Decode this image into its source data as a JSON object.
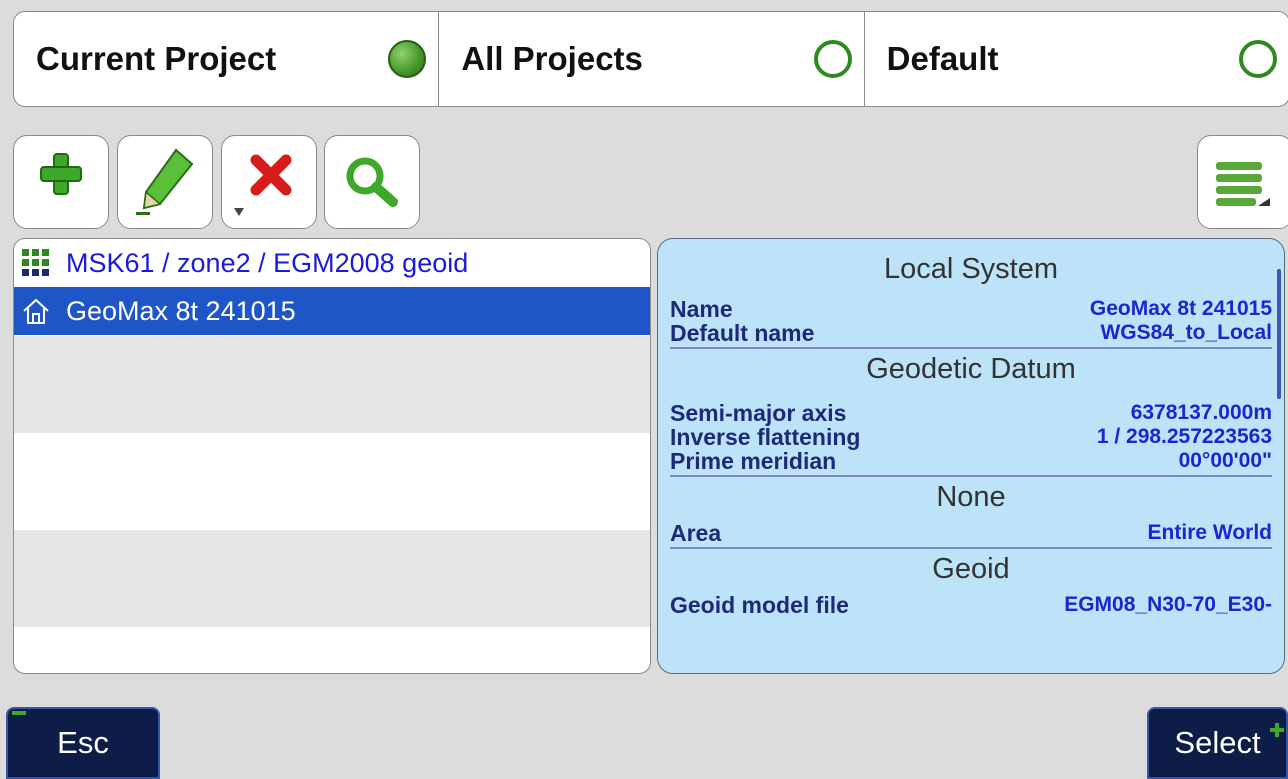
{
  "tabs": [
    {
      "label": "Current Project",
      "selected": true
    },
    {
      "label": "All Projects",
      "selected": false
    },
    {
      "label": "Default",
      "selected": false
    }
  ],
  "toolbar": {
    "icons": [
      "add-icon",
      "edit-icon",
      "delete-icon",
      "search-icon",
      "menu-icon"
    ],
    "colors": {
      "add": "#3da82a",
      "delete": "#d81b1b",
      "search": "#3da82a",
      "menu": "#4a8a2a"
    }
  },
  "list": {
    "items": [
      {
        "label": "MSK61 / zone2 / EGM2008 geoid",
        "icon": "grid-icon",
        "selected": false
      },
      {
        "label": "GeoMax 8t 241015",
        "icon": "home-icon",
        "selected": true
      }
    ],
    "selected_color": "#1e56c8"
  },
  "info": {
    "sections": {
      "local_system": {
        "title": "Local System",
        "name_label": "Name",
        "name_value": "GeoMax 8t 241015",
        "default_label": "Default name",
        "default_value": "WGS84_to_Local"
      },
      "datum": {
        "title": "Geodetic Datum",
        "axis_label": "Semi-major axis",
        "axis_value": "6378137.000m",
        "flat_label": "Inverse flattening",
        "flat_value": "1 / 298.257223563",
        "meridian_label": "Prime meridian",
        "meridian_value": "00°00'00\""
      },
      "none": {
        "title": "None",
        "area_label": "Area",
        "area_value": "Entire World"
      },
      "geoid": {
        "title": "Geoid",
        "model_label": "Geoid model file",
        "model_value": "EGM08_N30-70_E30-"
      }
    }
  },
  "softkeys": {
    "esc": "Esc",
    "select": "Select"
  }
}
